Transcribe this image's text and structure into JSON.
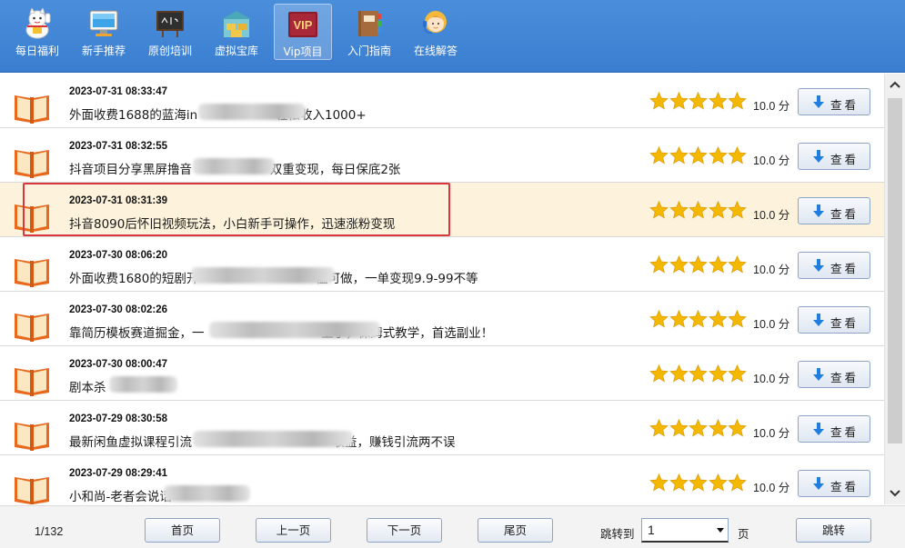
{
  "toolbar": {
    "items": [
      {
        "label": "每日福利",
        "icon": "lucky-cat-icon"
      },
      {
        "label": "新手推荐",
        "icon": "monitor-icon"
      },
      {
        "label": "原创培训",
        "icon": "blackboard-icon"
      },
      {
        "label": "虚拟宝库",
        "icon": "warehouse-icon"
      },
      {
        "label": "Vip项目",
        "icon": "vip-icon",
        "icon_text": "VIP",
        "active": true
      },
      {
        "label": "入门指南",
        "icon": "guide-book-icon"
      },
      {
        "label": "在线解答",
        "icon": "support-agent-icon"
      }
    ]
  },
  "list": {
    "rows": [
      {
        "date": "2023-07-31 08:33:47",
        "title": "外面收费1688的蓝海in                    轻松收入1000+",
        "score": "10.0 分",
        "rating": 5
      },
      {
        "date": "2023-07-31 08:32:55",
        "title": "抖音项目分享黑屏撸音                    双重变现，每日保底2张",
        "score": "10.0 分",
        "rating": 5
      },
      {
        "date": "2023-07-31 08:31:39",
        "title": "抖音8090后怀旧视频玩法，小白新手可操作，迅速涨粉变现",
        "score": "10.0 分",
        "rating": 5,
        "selected": true
      },
      {
        "date": "2023-07-30 08:06:20",
        "title": "外面收费1680的短剧开                              槛可做，一单变现9.9-99不等",
        "score": "10.0 分",
        "rating": 5
      },
      {
        "date": "2023-07-30 08:02:26",
        "title": "靠简历模板赛道掘金，一                              上手，保姆式教学，首选副业！",
        "score": "10.0 分",
        "rating": 5
      },
      {
        "date": "2023-07-30 08:00:47",
        "title": "剧本杀",
        "score": "10.0 分",
        "rating": 5
      },
      {
        "date": "2023-07-29 08:30:58",
        "title": "最新闲鱼虚拟课程引流                                    收益，赚钱引流两不误",
        "score": "10.0 分",
        "rating": 5
      },
      {
        "date": "2023-07-29 08:29:41",
        "title": "小和尚-老者会说话",
        "score": "10.0 分",
        "rating": 5
      }
    ],
    "view_label": "查看",
    "star_color": "#f5b800"
  },
  "footer": {
    "page_info": "1/132",
    "first_label": "首页",
    "prev_label": "上一页",
    "next_label": "下一页",
    "last_label": "尾页",
    "jump_label": "跳转到",
    "jump_value": "1",
    "jump_unit": "页",
    "jump_button": "跳转"
  },
  "colors": {
    "toolbar_bg": "#3b7ed0",
    "selected_row": "#fdf3dc",
    "highlight_border": "#d9363e",
    "book_orange": "#e8691e"
  }
}
